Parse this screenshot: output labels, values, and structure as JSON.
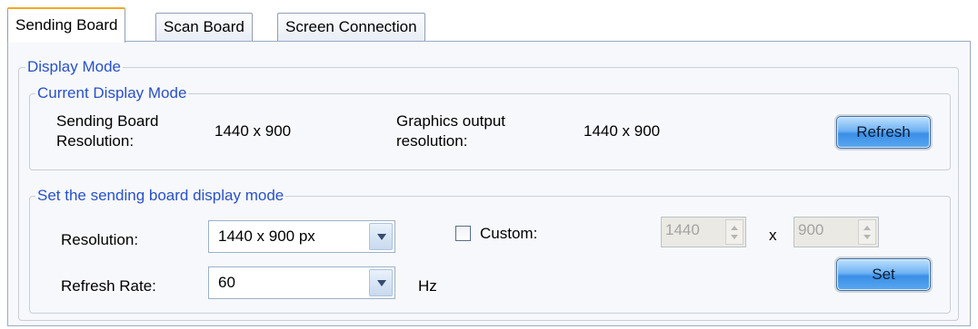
{
  "tabs": [
    {
      "label": "Sending Board",
      "active": true
    },
    {
      "label": "Scan Board",
      "active": false
    },
    {
      "label": "Screen Connection",
      "active": false
    }
  ],
  "display_mode": {
    "title": "Display Mode",
    "current": {
      "title": "Current Display Mode",
      "sending_res_label_line1": "Sending Board",
      "sending_res_label_line2": "Resolution:",
      "sending_res_value": "1440 x 900",
      "graphics_label_line1": "Graphics output",
      "graphics_label_line2": "resolution:",
      "graphics_value": "1440 x 900",
      "refresh_button": "Refresh"
    },
    "set_mode": {
      "title": "Set the sending board display mode",
      "resolution_label": "Resolution:",
      "resolution_value": "1440 x 900 px",
      "custom_label": "Custom:",
      "custom_checked": false,
      "custom_width": "1440",
      "times": "x",
      "custom_height": "900",
      "refresh_rate_label": "Refresh Rate:",
      "refresh_rate_value": "60",
      "hz_label": "Hz",
      "set_button": "Set"
    }
  },
  "colors": {
    "legend_text": "#2851c6",
    "active_tab_accent": "#f5a623",
    "button_blue": "#3a8ee6"
  }
}
